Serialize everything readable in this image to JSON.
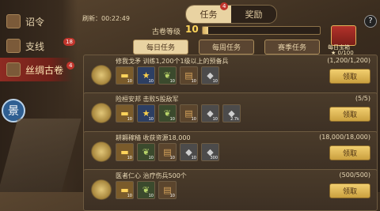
{
  "sidebar": {
    "items": [
      {
        "label": "诏令",
        "badge": ""
      },
      {
        "label": "支线",
        "badge": "18"
      },
      {
        "label": "丝绸古卷",
        "badge": "4"
      }
    ],
    "seal_glyph": "景"
  },
  "header": {
    "refresh_label": "刷新：00:22:49",
    "tabs": [
      {
        "label": "任务",
        "badge": "4"
      },
      {
        "label": "奖励"
      }
    ],
    "help": "?"
  },
  "level": {
    "label": "古卷等级",
    "value": "10",
    "progress_fraction": 0.05
  },
  "chest": {
    "label": "每日宝箱",
    "score": "0/100"
  },
  "subtabs": [
    "每日任务",
    "每周任务",
    "赛季任务"
  ],
  "tasks": [
    {
      "title": "修我戈矛  训练1,200个1级以上的预备兵",
      "progress": "(1,200/1,200)",
      "claim": "领取",
      "rewards": [
        {
          "icon": "gold-ingot-icon",
          "count": "10"
        },
        {
          "icon": "star-icon",
          "count": "10"
        },
        {
          "icon": "wheat-icon",
          "count": "10"
        },
        {
          "icon": "wood-icon",
          "count": "10"
        },
        {
          "icon": "iron-icon",
          "count": "10"
        }
      ]
    },
    {
      "title": "险桓安邦  击败5股敌军",
      "progress": "(5/5)",
      "claim": "领取",
      "rewards": [
        {
          "icon": "gold-ingot-icon",
          "count": "10"
        },
        {
          "icon": "star-icon",
          "count": "10"
        },
        {
          "icon": "wheat-icon",
          "count": "10"
        },
        {
          "icon": "wood-icon",
          "count": "10"
        },
        {
          "icon": "iron-icon",
          "count": "10"
        },
        {
          "icon": "iron-icon",
          "count": "2.7k"
        }
      ]
    },
    {
      "title": "耕耨稼穑  收获资源18,000",
      "progress": "(18,000/18,000)",
      "claim": "领取",
      "rewards": [
        {
          "icon": "gold-ingot-icon",
          "count": "10"
        },
        {
          "icon": "wheat-icon",
          "count": "10"
        },
        {
          "icon": "wood-icon",
          "count": "10"
        },
        {
          "icon": "iron-icon",
          "count": "10"
        },
        {
          "icon": "iron-icon",
          "count": "300"
        }
      ]
    },
    {
      "title": "医者仁心  治疗伤兵500个",
      "progress": "(500/500)",
      "claim": "领取",
      "rewards": [
        {
          "icon": "gold-ingot-icon",
          "count": "10"
        },
        {
          "icon": "wheat-icon",
          "count": "10"
        },
        {
          "icon": "wood-icon",
          "count": "10"
        }
      ]
    }
  ]
}
